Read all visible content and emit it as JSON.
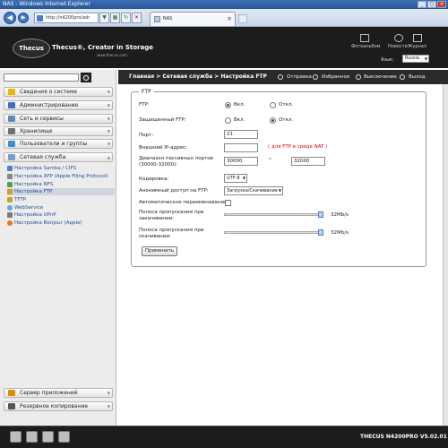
{
  "window": {
    "title": "NAS - Windows Internet Explorer"
  },
  "browser": {
    "address": "http://n4200pro/adr",
    "tab_title": "NAS"
  },
  "header": {
    "logo": "Thecus",
    "brand": "Thecus®, Creator in Storage",
    "url": "www.thecus.com",
    "links": [
      "Фотоальбом",
      "Новости",
      "Журнал"
    ],
    "language_label": "Язык:",
    "language_value": "Russia"
  },
  "sidebar": {
    "search_value": "",
    "categories": [
      {
        "label": "Сведения о системе",
        "color": "#e6b800"
      },
      {
        "label": "Администрирование",
        "color": "#3c6fc1"
      },
      {
        "label": "Сеть и сервисы",
        "color": "#5c8ab5"
      },
      {
        "label": "Хранилище",
        "color": "#6f6f6f"
      },
      {
        "label": "Пользователи и группы",
        "color": "#3b8fd6"
      },
      {
        "label": "Сетевая служба",
        "color": "#7a9bd0"
      }
    ],
    "items": [
      "Настройка Samba / CIFS",
      "Настройка AFP (Apple Filing Protocol)",
      "Настройка NFS",
      "Настройка FTP",
      "TFTP",
      "WebService",
      "Настройка UPnP",
      "Настройка Bonjour (Apple)"
    ],
    "bottom_categories": [
      {
        "label": "Сервер приложений",
        "color": "#e08a00"
      },
      {
        "label": "Резервное копирование",
        "color": "#555555"
      }
    ]
  },
  "breadcrumb": {
    "path": "Главная > Сетевая служба > Настройка FTP",
    "links": [
      "Отправка",
      "Избранное",
      "Выключение",
      "Выход"
    ]
  },
  "ftp": {
    "legend": "FTP",
    "ftp_label": "FTP:",
    "ftp_on": "Вкл.",
    "ftp_off": "Откл.",
    "secure_label": "Защищенный FTP:",
    "secure_on": "Вкл.",
    "secure_off": "Откл.",
    "port_label": "Порт:",
    "port_value": "21",
    "ext_ip_label": "Внешний IP-адрес:",
    "ext_ip_value": "",
    "ext_ip_note": "( для FTP в среде NAT )",
    "passive_label": "Диапазон пассивных портов (30000-32000):",
    "passive_from": "30000",
    "passive_sep": "~",
    "passive_to": "32000",
    "encoding_label": "Кодировка:",
    "encoding_value": "UTF-8",
    "anon_label": "Анонимный доступ на FTP:",
    "anon_value": "Загрузка/Скачивание",
    "autorename_label": "Автоматическое переименование:",
    "upload_bw_label": "Полоса пропускания при закачивании:",
    "upload_bw_value": "32Mb/s",
    "download_bw_label": "Полоса пропускания при скачивании:",
    "download_bw_value": "32Mb/s",
    "apply": "Применить"
  },
  "footer": {
    "version": "THECUS N4200PRO V5.02.01"
  }
}
